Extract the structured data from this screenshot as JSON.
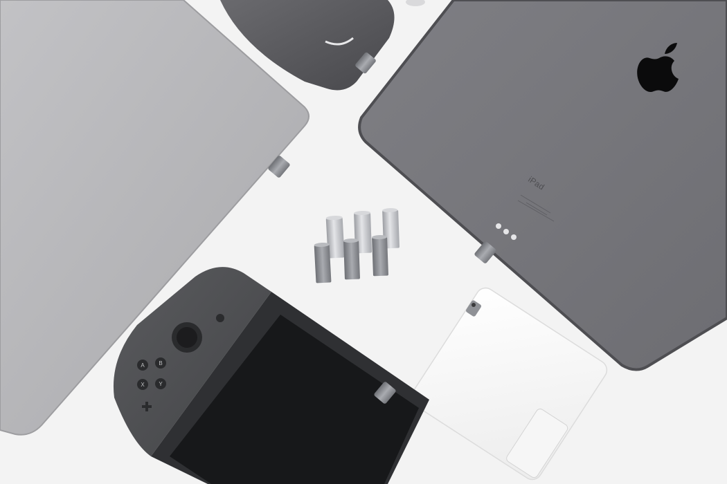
{
  "photo": {
    "background_color": "#f3f3f3",
    "objects": [
      {
        "name": "laptop",
        "color": "#b5b5b8",
        "icon": "laptop-icon"
      },
      {
        "name": "portable-ssd",
        "color": "#5a5a5e",
        "icon": "ssd-drive-icon"
      },
      {
        "name": "ipad",
        "color": "#77777c",
        "icon": "tablet-icon"
      },
      {
        "name": "aluminum-adapters",
        "count": 6,
        "color": "#c9cacd",
        "icon": "usb-c-adapter-icon"
      },
      {
        "name": "game-console",
        "color": "#4c4d50",
        "icon": "game-console-icon"
      },
      {
        "name": "power-adapter",
        "color": "#f7f7f7",
        "icon": "power-adapter-icon"
      }
    ]
  },
  "ipad_label": "iPad",
  "controller_buttons": [
    "A",
    "B",
    "X",
    "Y"
  ]
}
